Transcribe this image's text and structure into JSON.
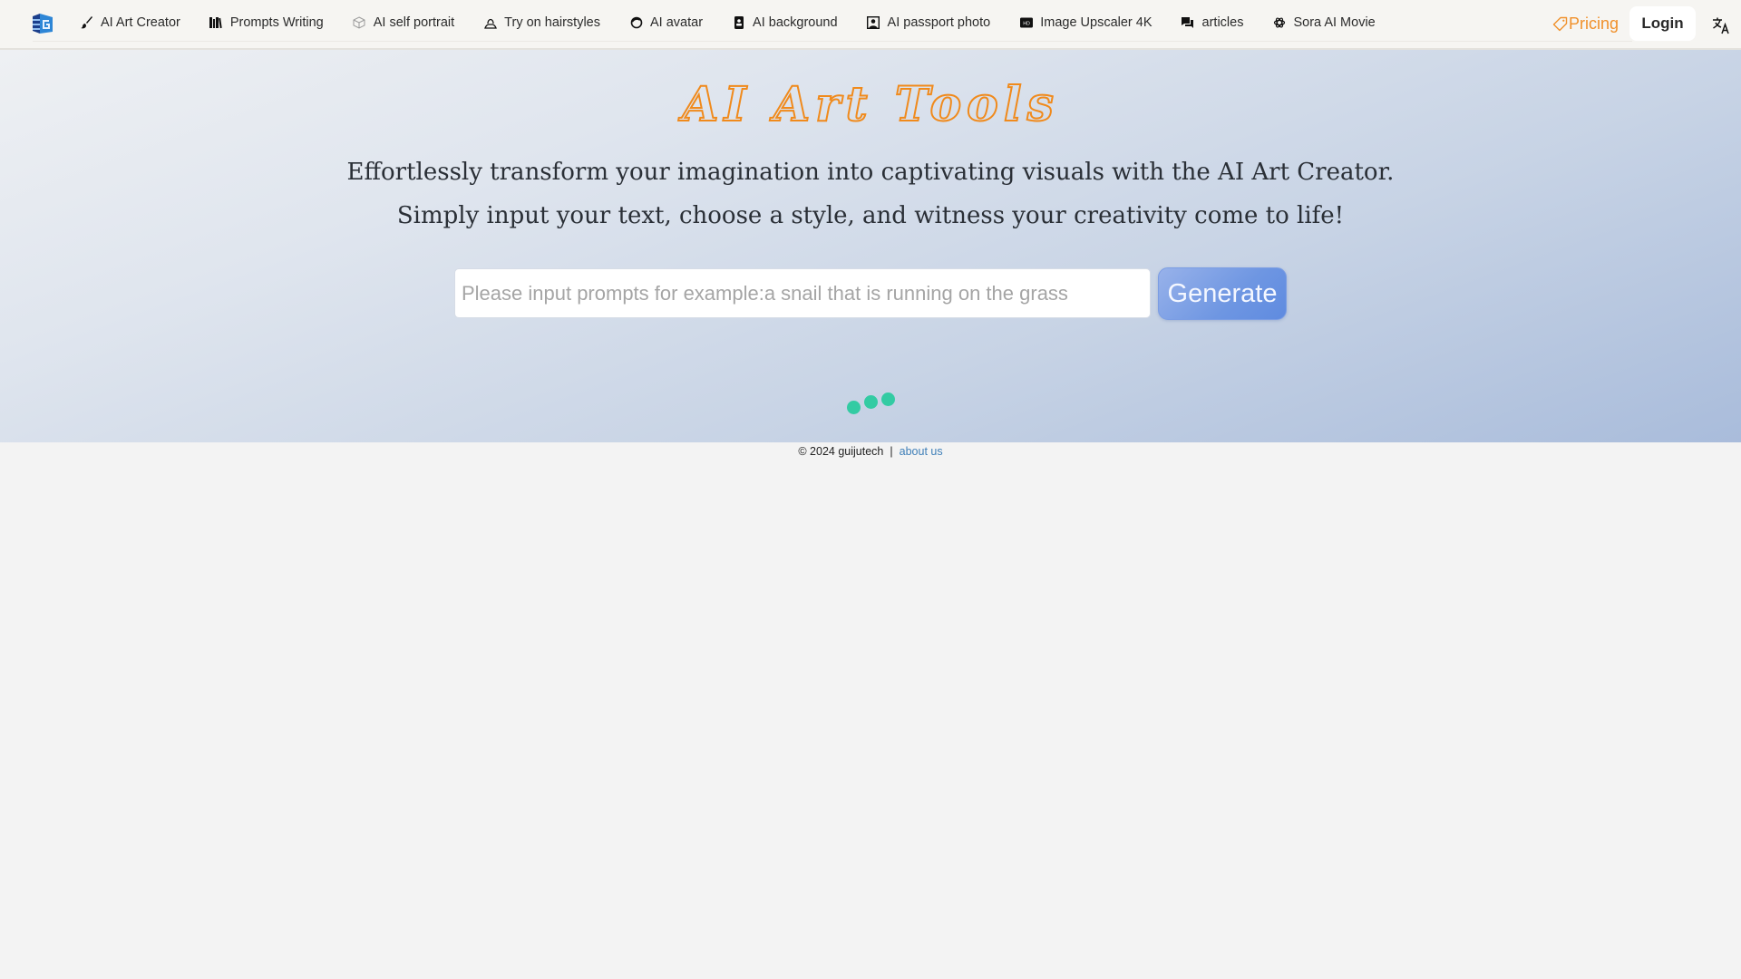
{
  "navbar": {
    "logo": "guijutech-logo",
    "items": [
      {
        "label": "AI Art Creator",
        "icon": "paintbrush-icon"
      },
      {
        "label": "Prompts Writing",
        "icon": "books-icon"
      },
      {
        "label": "AI self portrait",
        "icon": "cube-icon"
      },
      {
        "label": "Try on hairstyles",
        "icon": "person-outline-icon"
      },
      {
        "label": "AI avatar",
        "icon": "face-icon"
      },
      {
        "label": "AI background",
        "icon": "contact-card-icon"
      },
      {
        "label": "AI passport photo",
        "icon": "portrait-frame-icon"
      },
      {
        "label": "Image Upscaler 4K",
        "icon": "hd-icon"
      },
      {
        "label": "articles",
        "icon": "chat-bubbles-icon"
      },
      {
        "label": "Sora AI Movie",
        "icon": "openai-icon"
      }
    ],
    "pricing_label": "Pricing",
    "pricing_icon": "tag-icon",
    "login_label": "Login",
    "translate_icon": "translate-icon"
  },
  "hero": {
    "title": "AI Art Tools",
    "subtitle_line1": "Effortlessly transform your imagination into captivating visuals with the AI Art Creator.",
    "subtitle_line2": "Simply input your text, choose a style, and witness your creativity come to life!",
    "prompt_placeholder": "Please input prompts for example:a snail that is running on the grass",
    "prompt_value": "",
    "generate_label": "Generate",
    "loader_state": "loading"
  },
  "footer": {
    "copyright": "© 2024 guijutech",
    "separator": "|",
    "about_label": "about us"
  },
  "colors": {
    "accent_orange": "#f08a1c",
    "loader_green": "#33cba3",
    "generate_blue": "#6e96e2",
    "link_blue": "#3f7fb8"
  }
}
